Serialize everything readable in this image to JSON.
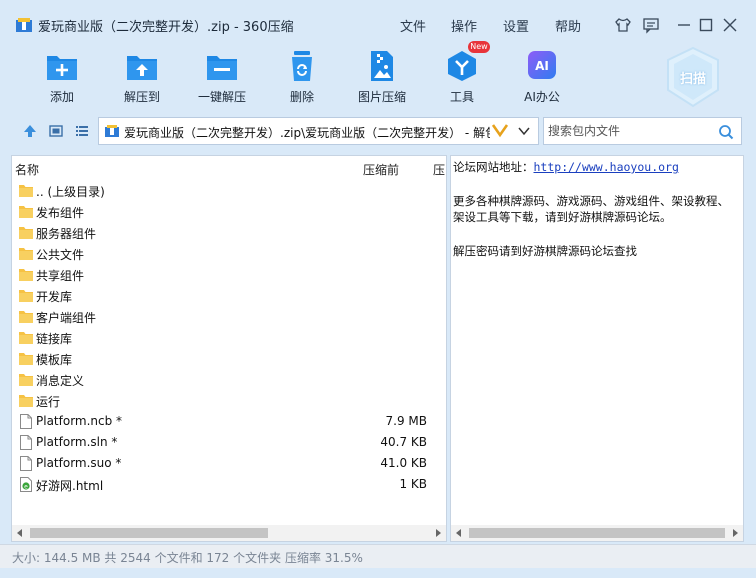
{
  "window": {
    "title": "爱玩商业版（二次完整开发）.zip - 360压缩",
    "menus": [
      "文件",
      "操作",
      "设置",
      "帮助"
    ]
  },
  "toolbar": {
    "items": [
      {
        "label": "添加",
        "icon": "add-icon"
      },
      {
        "label": "解压到",
        "icon": "extract-to-icon"
      },
      {
        "label": "一键解压",
        "icon": "one-click-extract-icon"
      },
      {
        "label": "删除",
        "icon": "delete-icon"
      },
      {
        "label": "图片压缩",
        "icon": "image-compress-icon"
      },
      {
        "label": "工具",
        "icon": "tools-icon"
      },
      {
        "label": "AI办公",
        "icon": "ai-office-icon"
      }
    ],
    "new_badge": "New",
    "scan_label": "扫描"
  },
  "address": {
    "path": "爱玩商业版（二次完整开发）.zip\\爱玩商业版（二次完整开发） - 解包",
    "search_placeholder": "搜索包内文件"
  },
  "file_list": {
    "columns": [
      "名称",
      "压缩前",
      "压"
    ],
    "rows": [
      {
        "name": ".. (上级目录)",
        "size": "",
        "type": "folder"
      },
      {
        "name": "发布组件",
        "size": "",
        "type": "folder"
      },
      {
        "name": "服务器组件",
        "size": "",
        "type": "folder"
      },
      {
        "name": "公共文件",
        "size": "",
        "type": "folder"
      },
      {
        "name": "共享组件",
        "size": "",
        "type": "folder"
      },
      {
        "name": "开发库",
        "size": "",
        "type": "folder"
      },
      {
        "name": "客户端组件",
        "size": "",
        "type": "folder"
      },
      {
        "name": "链接库",
        "size": "",
        "type": "folder"
      },
      {
        "name": "模板库",
        "size": "",
        "type": "folder"
      },
      {
        "name": "消息定义",
        "size": "",
        "type": "folder"
      },
      {
        "name": "运行",
        "size": "",
        "type": "folder"
      },
      {
        "name": "Platform.ncb *",
        "size": "7.9 MB",
        "type": "file"
      },
      {
        "name": "Platform.sln *",
        "size": "40.7 KB",
        "type": "file"
      },
      {
        "name": "Platform.suo *",
        "size": "41.0 KB",
        "type": "file"
      },
      {
        "name": "好游网.html",
        "size": "1 KB",
        "type": "html"
      }
    ]
  },
  "comment": {
    "site_label": "论坛网站地址：",
    "site_url": "http://www.haoyou.org",
    "line2": "更多各种棋牌源码、游戏源码、游戏组件、架设教程、",
    "line3": "架设工具等下载，请到好游棋牌源码论坛。",
    "line4": "解压密码请到好游棋牌源码论坛查找"
  },
  "status": {
    "text": "大小: 144.5 MB 共 2544 个文件和 172 个文件夹 压缩率 31.5%"
  },
  "colors": {
    "accent_blue": "#1e88e5",
    "folder_yellow": "#f6c244",
    "chrome_bg": "#d9e9f8",
    "new_badge_red": "#e8343a"
  }
}
